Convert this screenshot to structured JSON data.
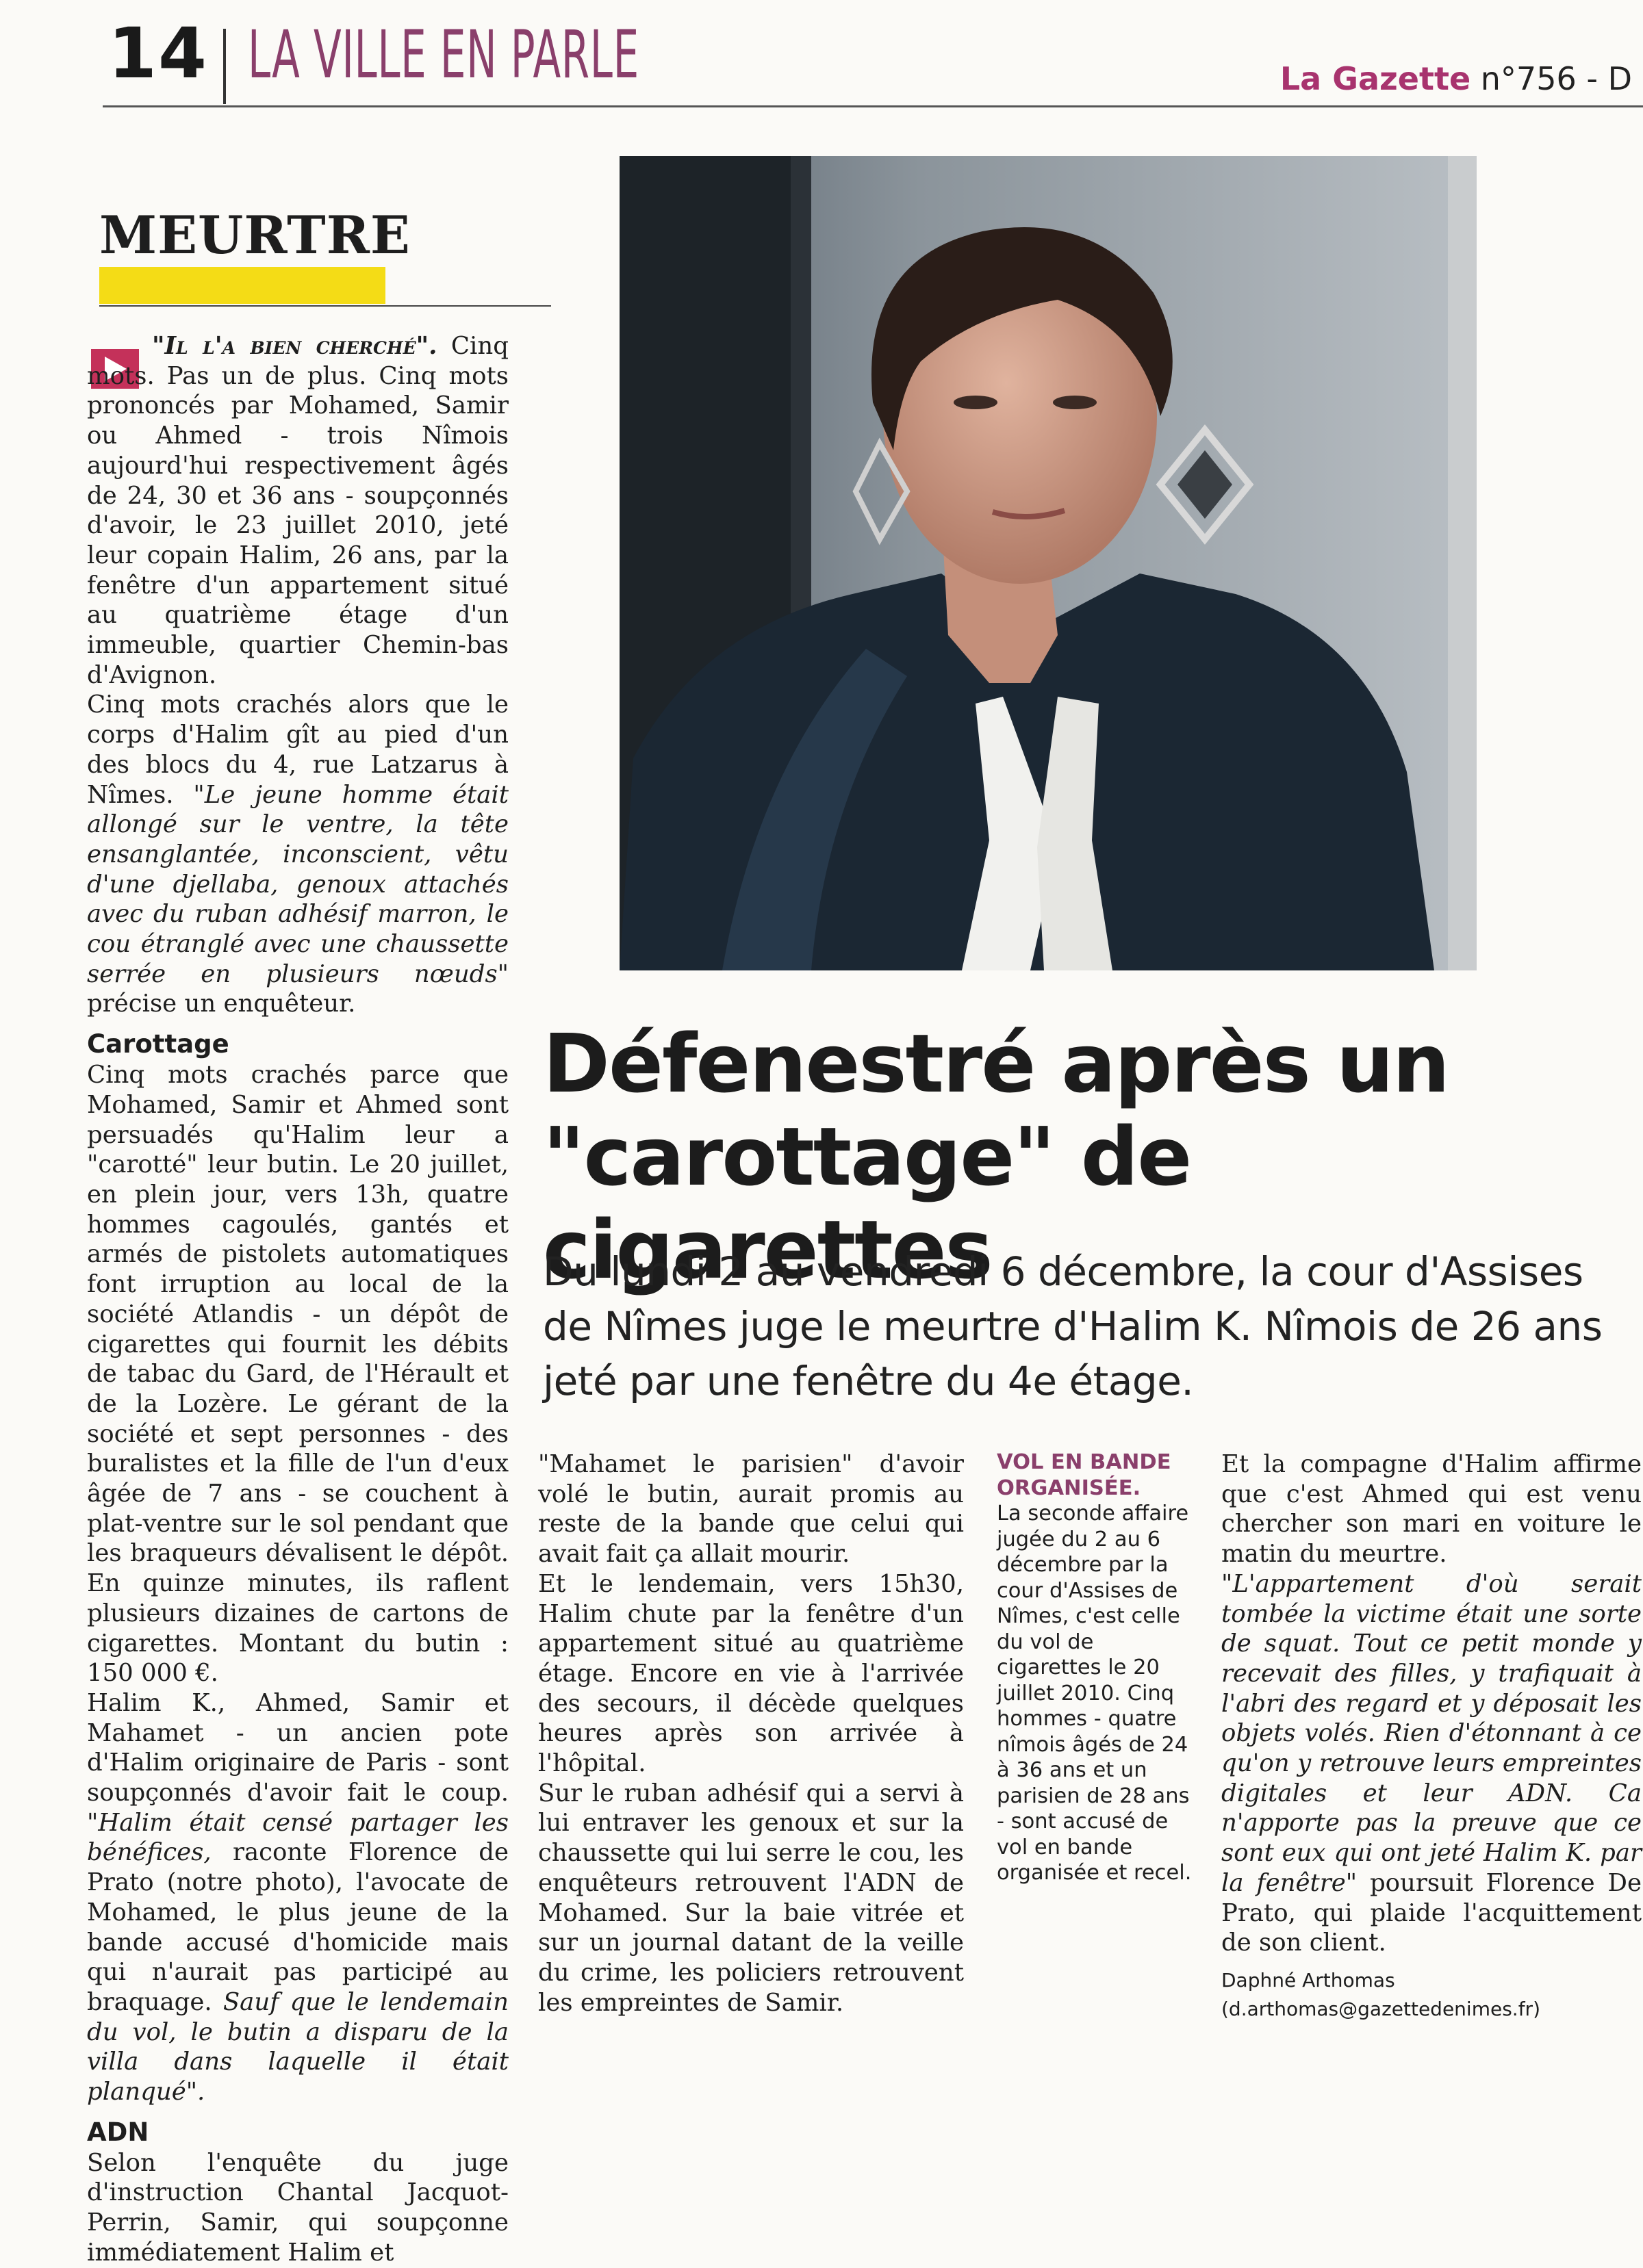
{
  "header": {
    "page_number": "14",
    "section": "LA VILLE EN PARLE",
    "publication": "La Gazette",
    "issue": "n°756 - D"
  },
  "kicker": "MEURTRE",
  "article": {
    "lead_quote": "\"Il l'a bien cherché\".",
    "col1_p1_rest": " Cinq mots. Pas un de plus. Cinq mots prononcés par Mohamed, Samir ou Ahmed - trois Nîmois aujourd'hui respectivement âgés de 24, 30 et 36 ans - soupçonnés d'avoir, le 23 juillet 2010, jeté leur copain Halim, 26 ans, par la fenêtre d'un appartement situé au quatrième étage d'un immeuble, quartier Chemin-bas d'Avignon.",
    "col1_p2_start": "Cinq mots crachés alors que le corps d'Halim gît au pied d'un des blocs du 4, rue Latzarus à Nîmes. ",
    "col1_p2_quote": "\"Le jeune homme était allongé sur le ventre, la tête ensanglantée, inconscient, vêtu d'une djellaba, genoux attachés avec du ruban adhésif marron, le cou étranglé avec une chaussette serrée en plusieurs nœuds\"",
    "col1_p2_end": " précise un enquêteur.",
    "subhead1": "Carottage",
    "col1_p3": "Cinq mots crachés parce que Mohamed, Samir et Ahmed sont persuadés qu'Halim leur a \"carotté\" leur butin. Le 20 juillet, en plein jour, vers 13h, quatre hommes cagoulés, gantés et armés de pistolets automatiques font irruption au local de la société Atlandis - un dépôt de cigarettes qui fournit les débits de tabac du Gard, de l'Hérault et de la Lozère. Le gérant de la société et sept personnes - des buralistes et la fille de l'un d'eux âgée de 7 ans - se couchent à plat-ventre sur le sol pendant que les braqueurs dévalisent le dépôt. En quinze minutes, ils raflent plusieurs dizaines de cartons de cigarettes. Montant du butin : 150 000 €.",
    "col1_p4_start": "Halim K., Ahmed, Samir et Mahamet - un ancien pote d'Halim originaire de Paris - sont soupçonnés d'avoir fait le coup. ",
    "col1_p4_quote1": "\"Halim était censé partager les bénéfices,",
    "col1_p4_mid": " raconte Florence de Prato (notre photo), l'avocate de Mohamed, le plus jeune de la bande accusé d'homicide mais qui n'aurait pas participé au braquage. ",
    "col1_p4_quote2": "Sauf que le lendemain du vol, le butin a disparu de la villa dans laquelle il était planqué\".",
    "subhead2": "ADN",
    "col1_p5": "Selon l'enquête du juge d'instruction Chantal Jacquot-Perrin, Samir, qui soupçonne immédiatement Halim et",
    "col2_p1": "\"Mahamet le parisien\" d'avoir volé le butin, aurait promis au reste de la bande que celui qui avait fait ça allait mourir.",
    "col2_p2": "Et le lendemain, vers 15h30, Halim chute par la fenêtre d'un appartement situé au quatrième étage. Encore en vie à l'arrivée des secours, il décède quelques heures après son arrivée à l'hôpital.",
    "col2_p3": "Sur le ruban adhésif qui a servi à lui entraver les genoux et sur la chaussette qui lui serre le cou, les enquêteurs retrouvent l'ADN de Mohamed. Sur la baie vitrée et sur un journal datant de la veille du crime, les policiers retrouvent les empreintes de Samir.",
    "col4_p1": "Et la compagne d'Halim affirme que c'est Ahmed qui est venu chercher son mari en voiture le matin du meurtre.",
    "col4_p2_quote": "\"L'appartement d'où serait tombée la victime était une sorte de squat. Tout ce petit monde y recevait des filles, y trafiquait à l'abri des regard et y déposait les objets volés. Rien d'étonnant à ce qu'on y retrouve leurs empreintes digitales et leur ADN. Ca n'apporte pas la preuve que ce sont eux qui ont jeté Halim K. par la fenêtre\"",
    "col4_p2_end": " poursuit Florence De Prato, qui plaide l'acquittement de son client."
  },
  "headline": {
    "line1": "Défenestré après un",
    "line2": "\"carottage\" de cigarettes"
  },
  "standfirst": "Du lundi 2 au vendredi 6 décembre, la cour d'Assises de Nîmes juge le meurtre d'Halim K. Nîmois de 26 ans jeté par une fenêtre du 4e étage.",
  "sidebar": {
    "title": "VOL EN BANDE ORGANISÉE.",
    "text": "La seconde affaire jugée du 2 au 6 décembre par la cour d'Assises de Nîmes, c'est celle du vol de cigarettes le 20 juillet 2010. Cinq hommes - quatre nîmois âgés de 24 à 36 ans et un parisien de 28 ans - sont accusé de vol en bande organisée et recel."
  },
  "byline": {
    "author": "Daphné Arthomas",
    "email": "(d.arthomas@gazettedenimes.fr)"
  }
}
